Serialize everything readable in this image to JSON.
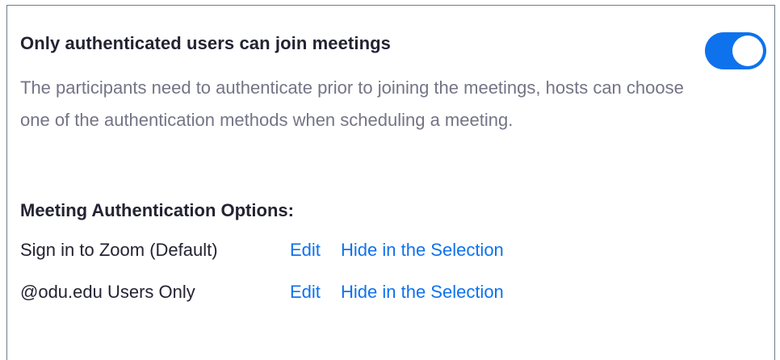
{
  "setting": {
    "title": "Only authenticated users can join meetings",
    "description": "The participants need to authenticate prior to joining the meetings, hosts can choose one of the authentication methods when scheduling a meeting.",
    "enabled": true
  },
  "options": {
    "heading": "Meeting Authentication Options:",
    "items": [
      {
        "label": "Sign in to Zoom (Default)",
        "edit_label": "Edit",
        "hide_label": "Hide in the Selection"
      },
      {
        "label": "@odu.edu Users Only",
        "edit_label": "Edit",
        "hide_label": "Hide in the Selection"
      }
    ]
  },
  "colors": {
    "accent": "#0e72ed",
    "title_text": "#232333",
    "description_text": "#747487",
    "panel_border": "#6b7b8c"
  }
}
